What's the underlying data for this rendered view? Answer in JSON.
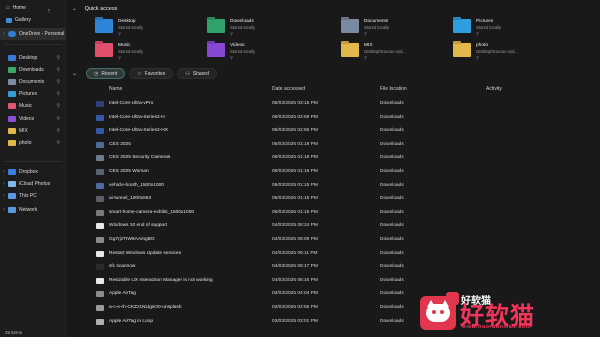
{
  "sidebar": {
    "home_label": "Home",
    "gallery_label": "Gallery",
    "onedrive_label": "OneDrive - Personal",
    "pinned": [
      {
        "label": "Desktop",
        "color": "#3a7bd5"
      },
      {
        "label": "Downloads",
        "color": "#3aa86b"
      },
      {
        "label": "Documents",
        "color": "#7d8da3"
      },
      {
        "label": "Pictures",
        "color": "#3a9bd9"
      },
      {
        "label": "Music",
        "color": "#e2566f"
      },
      {
        "label": "Videos",
        "color": "#8a4fd3"
      },
      {
        "label": "MIX",
        "color": "#e1b84a"
      },
      {
        "label": "photo",
        "color": "#e1b84a"
      }
    ],
    "locations": [
      {
        "label": "Dropbox",
        "color": "#3d7fe0"
      },
      {
        "label": "iCloud Photos",
        "color": "#7fb8e8"
      },
      {
        "label": "This PC",
        "color": "#5b9ae0"
      },
      {
        "label": "Network",
        "color": "#5b9ae0"
      }
    ],
    "status": "28 items"
  },
  "quick_access": {
    "title": "Quick access",
    "items": [
      {
        "name": "Desktop",
        "sub": "Stored locally",
        "color": "#2f86d8"
      },
      {
        "name": "Downloads",
        "sub": "Stored locally",
        "color": "#2fa36b"
      },
      {
        "name": "Documents",
        "sub": "Stored locally",
        "color": "#7a8aa0"
      },
      {
        "name": "Pictures",
        "sub": "Stored locally",
        "color": "#2f9ee0"
      },
      {
        "name": "Music",
        "sub": "Stored locally",
        "color": "#e0506c"
      },
      {
        "name": "Videos",
        "sub": "Stored locally",
        "color": "#8647d4"
      },
      {
        "name": "MIX",
        "sub": "Desktop\\Gourav and...",
        "color": "#e3b84a"
      },
      {
        "name": "photo",
        "sub": "Desktop\\Gourav and...",
        "color": "#e3b84a"
      }
    ]
  },
  "filters": {
    "recent": "Recent",
    "favorites": "Favorites",
    "shared": "Shared"
  },
  "columns": {
    "name": "Name",
    "date": "Date accessed",
    "location": "File location",
    "activity": "Activity"
  },
  "files": [
    {
      "name": "Intel-Core-Ultra-vPro",
      "date": "06/03/2025 03:15 PM",
      "loc": "Downloads",
      "color": "#2b3f7a"
    },
    {
      "name": "Intel-Core-Ultra-Series2-H",
      "date": "06/03/2025 02:59 PM",
      "loc": "Downloads",
      "color": "#3558a8"
    },
    {
      "name": "Intel-Core-Ultra-Series2-HX",
      "date": "06/03/2025 02:59 PM",
      "loc": "Downloads",
      "color": "#3558a8"
    },
    {
      "name": "CES 2025",
      "date": "06/03/2025 01:19 PM",
      "loc": "Downloads",
      "color": "#4a6d9a"
    },
    {
      "name": "CES 2025 Security Cameras",
      "date": "06/03/2025 01:18 PM",
      "loc": "Downloads",
      "color": "#6d7d8d"
    },
    {
      "name": "CES 2025 Woman",
      "date": "06/03/2025 01:16 PM",
      "loc": "Downloads",
      "color": "#5a6470"
    },
    {
      "name": "vehicle-booth_1500x1000",
      "date": "06/03/2025 01:15 PM",
      "loc": "Downloads",
      "color": "#4d6b9e"
    },
    {
      "name": "ai-tunnel_1000x563",
      "date": "06/03/2025 01:15 PM",
      "loc": "Downloads",
      "color": "#5e5e6a"
    },
    {
      "name": "smart-home-camera-exhibit_1500x1000",
      "date": "06/03/2025 01:15 PM",
      "loc": "Downloads",
      "color": "#7a7a7a"
    },
    {
      "name": "Windows 10 end of support",
      "date": "04/03/2025 08:24 PM",
      "loc": "Downloads",
      "color": "#e8e8e8"
    },
    {
      "name": "Gg7rjzTIW8AAmgBG",
      "date": "04/03/2025 06:09 PM",
      "loc": "Downloads",
      "color": "#8a8a8a"
    },
    {
      "name": "Restart Windows Update services",
      "date": "04/03/2025 06:11 PM",
      "loc": "Downloads",
      "color": "#e8e8e8"
    },
    {
      "name": "sfc scannow",
      "date": "04/03/2025 06:17 PM",
      "loc": "Downloads",
      "color": "#2a2a2a"
    },
    {
      "name": "Resizable UX Interaction Manager is not working",
      "date": "04/03/2025 06:16 PM",
      "loc": "Downloads",
      "color": "#e8e8e8"
    },
    {
      "name": "Apple AirTag",
      "date": "03/03/2025 04:04 PM",
      "loc": "Downloads",
      "color": "#8c8c8c"
    },
    {
      "name": "a-c-e-rh-CKZz1NtJgsO0-unsplash",
      "date": "03/03/2025 02:55 PM",
      "loc": "Downloads",
      "color": "#9a9a9a"
    },
    {
      "name": "Apple AirTag in Loop",
      "date": "03/03/2025 03:01 PM",
      "loc": "Downloads",
      "color": "#b0b0b0"
    }
  ],
  "watermark": {
    "cn": "好软猫",
    "url": "www.haoruanmao.com",
    "small": "好软猫"
  }
}
